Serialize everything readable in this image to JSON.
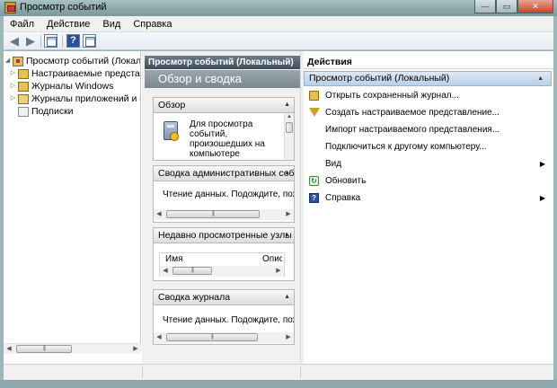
{
  "window": {
    "title": "Просмотр событий",
    "min_label": "—",
    "max_label": "▭",
    "close_label": "✕"
  },
  "menu": [
    "Файл",
    "Действие",
    "Вид",
    "Справка"
  ],
  "toolbar": {
    "back_icon": "◀",
    "forward_icon": "▶",
    "help_label": "?"
  },
  "tree": {
    "items": [
      {
        "label": "Просмотр событий (Локальный)",
        "arrow": "◢",
        "icon": "event-viewer-icon"
      },
      {
        "label": "Настраиваемые представления",
        "arrow": "▷",
        "icon": "folder-icon"
      },
      {
        "label": "Журналы Windows",
        "arrow": "▷",
        "icon": "folder-icon"
      },
      {
        "label": "Журналы приложений и служб",
        "arrow": "▷",
        "icon": "folder-icon"
      },
      {
        "label": "Подписки",
        "arrow": "",
        "icon": "subscriptions-icon"
      }
    ]
  },
  "middle": {
    "header": "Просмотр событий (Локальный)",
    "banner": "Обзор и сводка",
    "sections": [
      {
        "title": "Обзор",
        "body": "Для просмотра событий, произошедших на компьютере"
      },
      {
        "title": "Сводка административных событий",
        "body": "Чтение данных. Подождите, пожалуйста..."
      },
      {
        "title": "Недавно просмотренные узлы",
        "col1": "Имя",
        "col2": "Описание"
      },
      {
        "title": "Сводка журнала",
        "body": "Чтение данных. Подождите, пожалуйста..."
      }
    ]
  },
  "actions": {
    "title": "Действия",
    "group": "Просмотр событий (Локальный)",
    "items": [
      {
        "label": "Открыть сохраненный журнал...",
        "icon": "folder-open-icon",
        "submenu": false
      },
      {
        "label": "Создать настраиваемое представление...",
        "icon": "filter-icon",
        "submenu": false
      },
      {
        "label": "Импорт настраиваемого представления...",
        "icon": "",
        "submenu": false
      },
      {
        "label": "Подключиться к другому компьютеру...",
        "icon": "",
        "submenu": false
      },
      {
        "label": "Вид",
        "icon": "",
        "submenu": true
      },
      {
        "label": "Обновить",
        "icon": "refresh-icon",
        "submenu": false
      },
      {
        "label": "Справка",
        "icon": "help-icon",
        "submenu": true
      }
    ]
  }
}
